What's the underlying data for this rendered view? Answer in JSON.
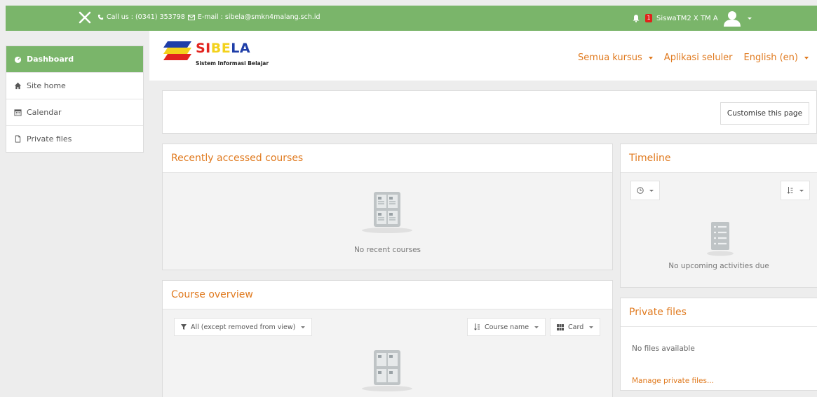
{
  "topbar": {
    "contact": "Call us : (0341) 353798",
    "email": "E-mail : sibela@smkn4malang.sch.id",
    "notif_count": "1",
    "user": "SiswaTM2 X TM A"
  },
  "sidebar": {
    "items": [
      {
        "label": "Dashboard"
      },
      {
        "label": "Site home"
      },
      {
        "label": "Calendar"
      },
      {
        "label": "Private files"
      }
    ]
  },
  "header": {
    "logo_title_a": "SI",
    "logo_title_b": "BE",
    "logo_title_c": "LA",
    "logo_subtitle": "Sistem Informasi Belajar",
    "nav": [
      "Semua kursus",
      "Aplikasi seluler",
      "English (en)"
    ]
  },
  "customise": {
    "label": "Customise this page"
  },
  "recent": {
    "title": "Recently accessed courses",
    "empty": "No recent courses"
  },
  "overview": {
    "title": "Course overview",
    "filter": "All (except removed from view)",
    "sort": "Course name",
    "view": "Card"
  },
  "timeline": {
    "title": "Timeline",
    "empty": "No upcoming activities due"
  },
  "private_files": {
    "title": "Private files",
    "empty": "No files available",
    "manage": "Manage private files..."
  },
  "colors": {
    "accent_green": "#7ab56a",
    "accent_orange": "#e07a1f"
  }
}
